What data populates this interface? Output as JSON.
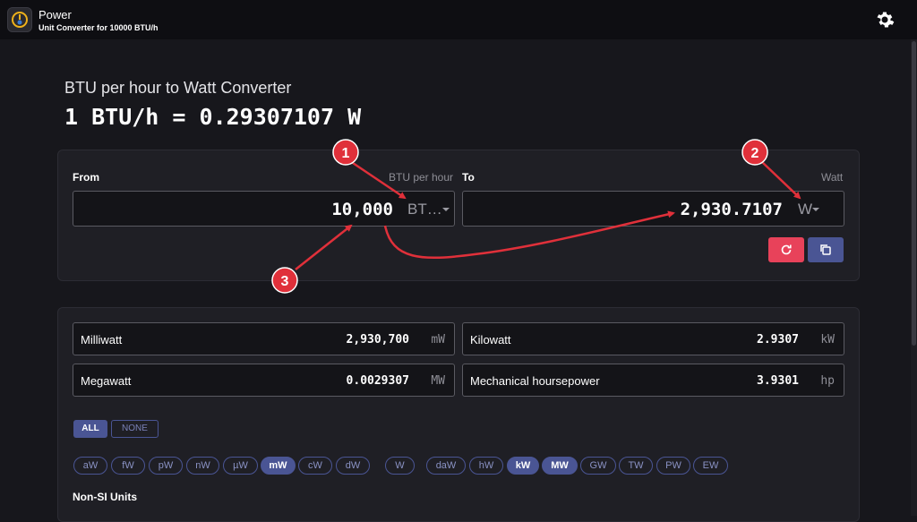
{
  "app": {
    "title": "Power",
    "subtitle": "Unit Converter for 10000 BTU/h",
    "icon": "power-converter-app-icon",
    "settings_icon": "gear-icon"
  },
  "converter": {
    "title": "BTU per hour to Watt Converter",
    "formula": "1 BTU/h = 0.29307107 W",
    "from": {
      "label": "From",
      "unit_name": "BTU per hour",
      "value": "10,000",
      "unit_short": "BT…"
    },
    "to": {
      "label": "To",
      "unit_name": "Watt",
      "value": "2,930.7107",
      "unit_short": "W"
    },
    "reset_icon": "refresh-icon",
    "copy_icon": "copy-icon",
    "reset_color": "#e8425a",
    "accent_color": "#4a5594"
  },
  "results": [
    {
      "name": "Milliwatt",
      "value": "2,930,700",
      "symbol": "mW"
    },
    {
      "name": "Kilowatt",
      "value": "2.9307",
      "symbol": "kW"
    },
    {
      "name": "Megawatt",
      "value": "0.0029307",
      "symbol": "MW"
    },
    {
      "name": "Mechanical hoursepower",
      "value": "3.9301",
      "symbol": "hp"
    }
  ],
  "filters": {
    "all_label": "ALL",
    "none_label": "NONE",
    "chips": [
      {
        "label": "aW",
        "active": false
      },
      {
        "label": "fW",
        "active": false
      },
      {
        "label": "pW",
        "active": false
      },
      {
        "label": "nW",
        "active": false
      },
      {
        "label": "µW",
        "active": false
      },
      {
        "label": "mW",
        "active": true
      },
      {
        "label": "cW",
        "active": false
      },
      {
        "label": "dW",
        "active": false
      },
      {
        "label": "W",
        "active": false
      },
      {
        "label": "daW",
        "active": false
      },
      {
        "label": "hW",
        "active": false
      },
      {
        "label": "kW",
        "active": true
      },
      {
        "label": "MW",
        "active": true
      },
      {
        "label": "GW",
        "active": false
      },
      {
        "label": "TW",
        "active": false
      },
      {
        "label": "PW",
        "active": false
      },
      {
        "label": "EW",
        "active": false
      }
    ]
  },
  "section": {
    "non_si_title": "Non-SI Units"
  },
  "annotations": {
    "color": "#e0303a",
    "badges": [
      "1",
      "2",
      "3"
    ]
  }
}
